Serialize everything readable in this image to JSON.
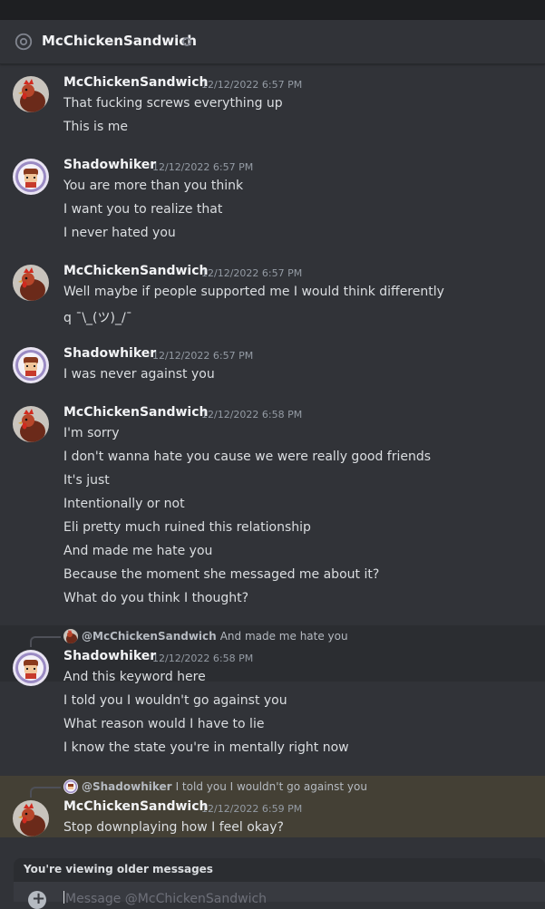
{
  "channel": {
    "title": "McChickenSandwich"
  },
  "messages": [
    {
      "author": "McChickenSandwich",
      "timestamp": "12/12/2022 6:57 PM",
      "lines": [
        "That fucking screws everything up",
        "This is me"
      ]
    },
    {
      "author": "Shadowhiker",
      "timestamp": "12/12/2022 6:57 PM",
      "lines": [
        "You are more than you think",
        "I want you to realize that",
        "I never hated you"
      ]
    },
    {
      "author": "McChickenSandwich",
      "timestamp": "12/12/2022 6:57 PM",
      "lines": [
        "Well maybe if people supported me I would think differently",
        "q ¯\\_(ツ)_/¯"
      ]
    },
    {
      "author": "Shadowhiker",
      "timestamp": "12/12/2022 6:57 PM",
      "lines": [
        "I was never against you"
      ]
    },
    {
      "author": "McChickenSandwich",
      "timestamp": "12/12/2022 6:58 PM",
      "lines": [
        "I'm sorry",
        "I don't wanna hate you cause we were really good friends",
        "It's just",
        "Intentionally or not",
        "Eli pretty much ruined this relationship",
        "And made me hate you",
        "Because the moment she messaged me about it?",
        "What do you think I thought?"
      ]
    },
    {
      "author": "Shadowhiker",
      "timestamp": "12/12/2022 6:58 PM",
      "reply": {
        "name": "@McChickenSandwich",
        "text": "And made me hate you"
      },
      "lines": [
        "And this keyword here",
        "I told you I wouldn't go against you",
        "What reason would I have to lie",
        "I know the state you're in mentally right now"
      ]
    },
    {
      "author": "McChickenSandwich",
      "timestamp": "12/12/2022 6:59 PM",
      "reply": {
        "name": "@Shadowhiker",
        "text": "I told you I wouldn't go against you"
      },
      "lines": [
        "Stop downplaying how I feel okay?"
      ]
    }
  ],
  "banner": {
    "text": "You're viewing older messages"
  },
  "composer": {
    "placeholder": "Message @McChickenSandwich"
  },
  "colors": {
    "background": "#313338",
    "header": "#313338",
    "mention_highlight": "#444035",
    "text": "#dbdee1"
  }
}
